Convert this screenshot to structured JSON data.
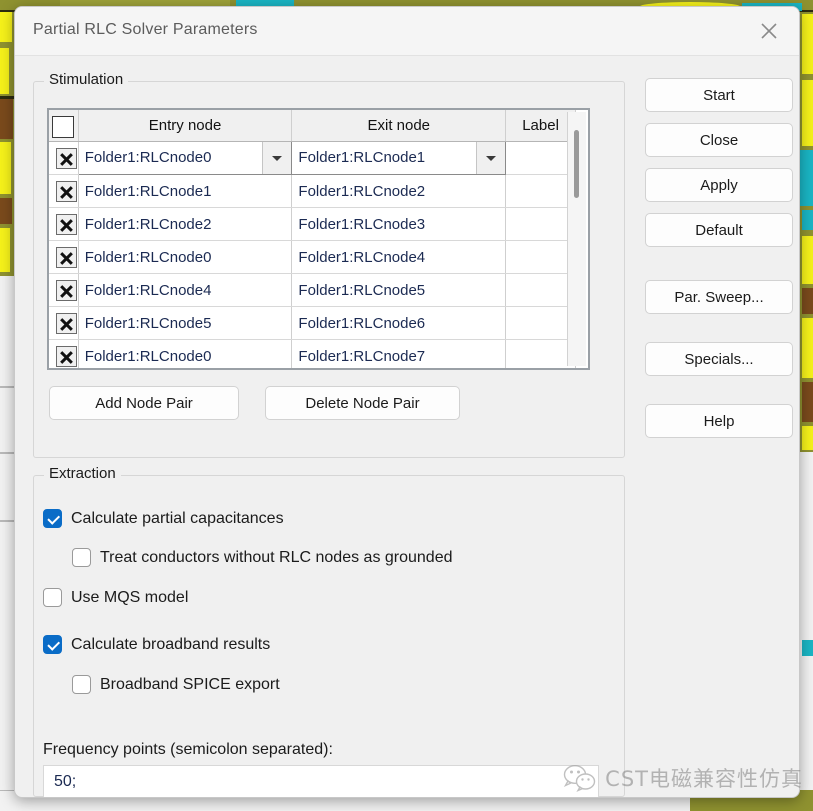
{
  "window": {
    "title": "Partial RLC Solver Parameters",
    "close_icon": "close-icon"
  },
  "stimulation": {
    "legend": "Stimulation",
    "table": {
      "columns": [
        "",
        "Entry node",
        "Exit node",
        "Label"
      ],
      "rows": [
        {
          "checked": true,
          "entry": "Folder1:RLCnode0",
          "exit": "Folder1:RLCnode1",
          "label": ""
        },
        {
          "checked": true,
          "entry": "Folder1:RLCnode1",
          "exit": "Folder1:RLCnode2",
          "label": ""
        },
        {
          "checked": true,
          "entry": "Folder1:RLCnode2",
          "exit": "Folder1:RLCnode3",
          "label": ""
        },
        {
          "checked": true,
          "entry": "Folder1:RLCnode0",
          "exit": "Folder1:RLCnode4",
          "label": ""
        },
        {
          "checked": true,
          "entry": "Folder1:RLCnode4",
          "exit": "Folder1:RLCnode5",
          "label": ""
        },
        {
          "checked": true,
          "entry": "Folder1:RLCnode5",
          "exit": "Folder1:RLCnode6",
          "label": ""
        },
        {
          "checked": true,
          "entry": "Folder1:RLCnode0",
          "exit": "Folder1:RLCnode7",
          "label": ""
        }
      ]
    },
    "add_node_pair": "Add Node Pair",
    "delete_node_pair": "Delete Node Pair"
  },
  "buttons": {
    "start": "Start",
    "close": "Close",
    "apply": "Apply",
    "default": "Default",
    "par_sweep": "Par. Sweep...",
    "specials": "Specials...",
    "help": "Help"
  },
  "extraction": {
    "legend": "Extraction",
    "options": [
      {
        "label": "Calculate partial capacitances",
        "checked": true,
        "indent": false
      },
      {
        "label": "Treat conductors without RLC nodes as grounded",
        "checked": false,
        "indent": true
      },
      {
        "label": "Use MQS model",
        "checked": false,
        "indent": false
      },
      {
        "label": "Calculate broadband results",
        "checked": true,
        "indent": false
      },
      {
        "label": "Broadband SPICE export",
        "checked": false,
        "indent": true
      }
    ],
    "frequency_label": "Frequency points (semicolon separated):",
    "frequency_value": "50;"
  },
  "watermark": {
    "text": "CST电磁兼容性仿真",
    "icon": "wechat-icon"
  },
  "colors": {
    "accent": "#0a6cc7",
    "dialog_bg": "#f0f0f0",
    "text": "#1b1b1b",
    "cell_text": "#1b2a52",
    "background_olive": "#8f9230",
    "background_yellow": "#f5f11a",
    "background_teal": "#1ab5c4"
  }
}
